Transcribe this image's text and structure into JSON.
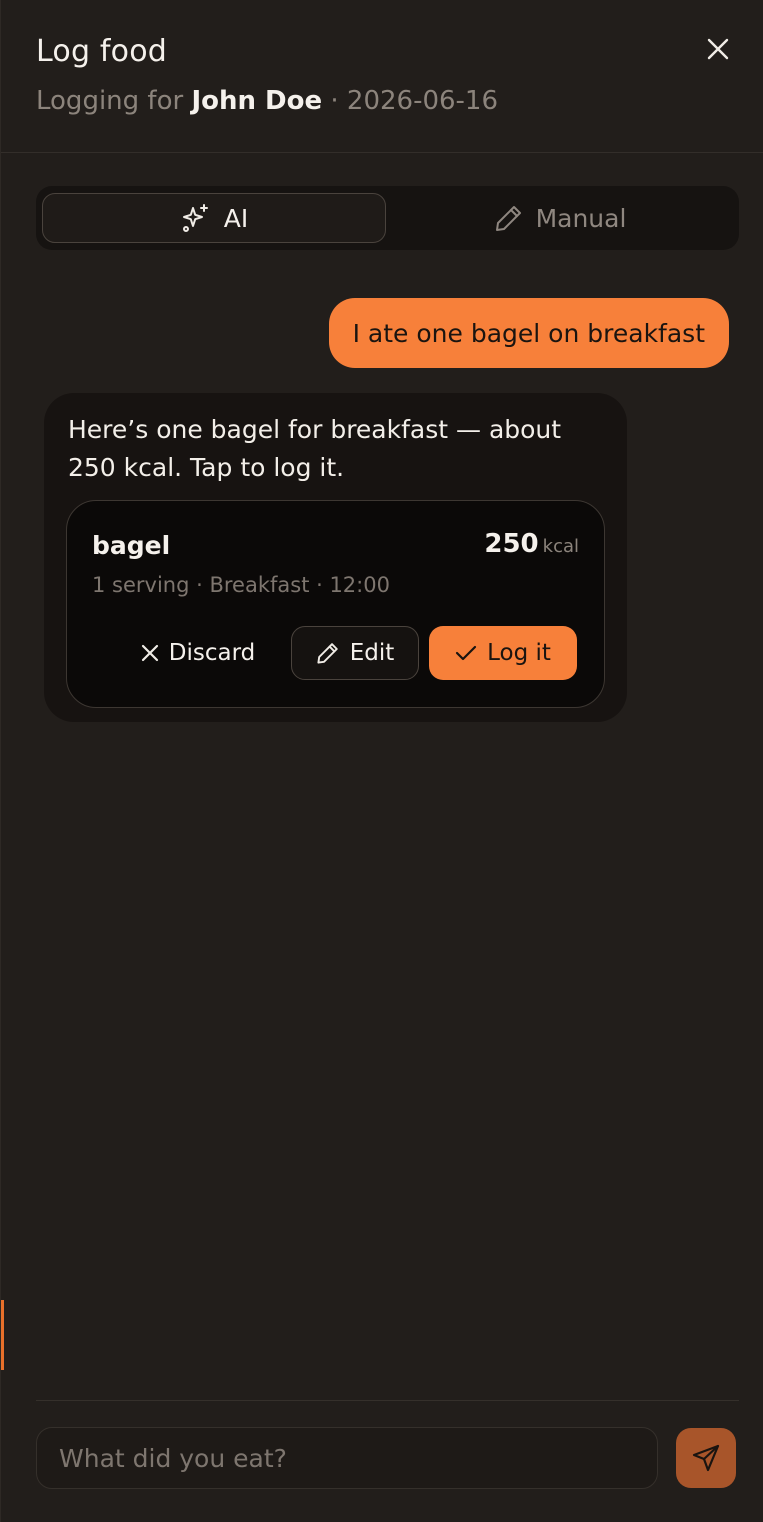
{
  "header": {
    "title": "Log food",
    "subtitle_prefix": "Logging for ",
    "user_name": "John Doe",
    "subtitle_suffix": " · 2026-06-16",
    "close_icon": "close-icon"
  },
  "mode_toggle": {
    "selected": "AI",
    "tabs": [
      {
        "label": "AI",
        "icon": "sparkles-icon"
      },
      {
        "label": "Manual",
        "icon": "pencil-icon"
      }
    ]
  },
  "chat": {
    "user_message": "I ate one bagel on breakfast",
    "assistant_message": "Here’s one bagel for breakfast — about 250 kcal. Tap to log it.",
    "food_card": {
      "name": "bagel",
      "kcal": "250",
      "kcal_unit": "kcal",
      "meta": "1 serving · Breakfast · 12:00",
      "actions": {
        "discard": "Discard",
        "edit": "Edit",
        "log": "Log it"
      }
    }
  },
  "composer": {
    "placeholder": "What did you eat?",
    "value": "",
    "send_icon": "send-icon"
  },
  "colors": {
    "accent": "#f7803a",
    "background": "#221e1b",
    "muted_text": "#8c847c"
  }
}
